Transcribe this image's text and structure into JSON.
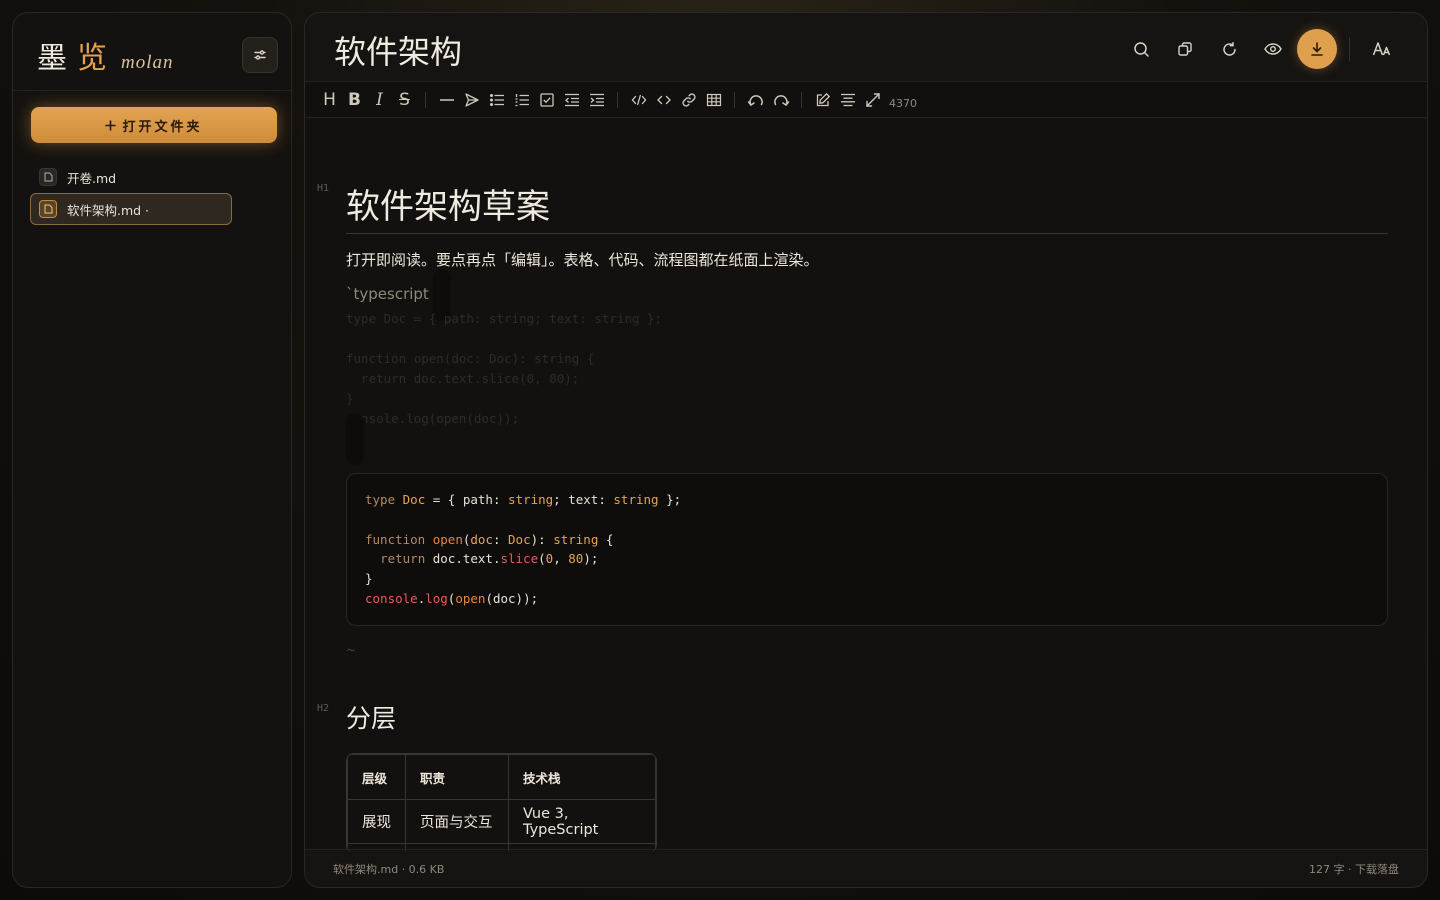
{
  "brand": {
    "cn_first": "墨",
    "cn_second": "览",
    "en": "molan"
  },
  "sidebar": {
    "open_folder_label": "打开文件夹",
    "files": [
      {
        "name": "开卷.md",
        "active": false
      },
      {
        "name": "软件架构.md ·",
        "active": true
      }
    ]
  },
  "header": {
    "title": "软件架构",
    "buttons": [
      "search-icon",
      "copy-icon",
      "refresh-icon",
      "eye-icon",
      "download-icon",
      "font-size-icon"
    ]
  },
  "toolbar": {
    "heading": "H",
    "bold": "B",
    "italic": "I",
    "strike": "S",
    "char_count": "4370"
  },
  "document": {
    "h1_marker": "H1",
    "h1": "软件架构草案",
    "paragraph": "打开即阅读。要点再点「编辑」。表格、代码、流程图都在纸面上渲染。",
    "fence_open": "`typescript",
    "ghost_lines": [
      "type Doc = { path: string; text: string };",
      "",
      "function open(doc: Doc): string {",
      "  return doc.text.slice(0, 80);",
      "}",
      "console.log(open(doc));"
    ],
    "fence_close": "~",
    "h2_marker": "H2",
    "h2": "分层",
    "table": {
      "headers": [
        "层级",
        "职责",
        "技术栈"
      ],
      "rows": [
        [
          "展现",
          "页面与交互",
          "Vue 3, TypeScript"
        ]
      ]
    }
  },
  "statusbar": {
    "left": "软件架构.md · 0.6 KB",
    "right": "127 字 · 下载落盘"
  },
  "colors": {
    "accent": "#dea04c",
    "bg": "#131110"
  }
}
